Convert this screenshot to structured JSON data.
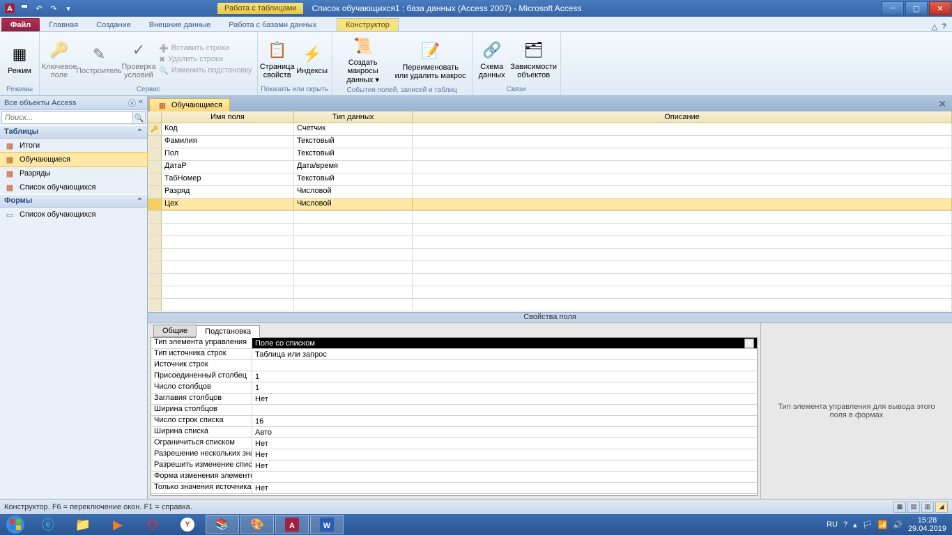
{
  "window": {
    "context_tab": "Работа с таблицами",
    "title": "Список обучающихся1 : база данных (Access 2007)  -  Microsoft Access"
  },
  "ribbon_tabs": {
    "file": "Файл",
    "home": "Главная",
    "create": "Создание",
    "external": "Внешние данные",
    "dbtools": "Работа с базами данных",
    "design": "Конструктор"
  },
  "ribbon": {
    "g1": {
      "mode": "Режим",
      "label": "Режимы"
    },
    "g2": {
      "key": "Ключевое\nполе",
      "builder": "Построитель",
      "check": "Проверка\nусловий",
      "ins": "Вставить строки",
      "del": "Удалить строки",
      "mod": "Изменить подстановку",
      "label": "Сервис"
    },
    "g3": {
      "props": "Страница\nсвойств",
      "idx": "Индексы",
      "label": "Показать или скрыть"
    },
    "g4": {
      "create": "Создать макросы\nданных ▾",
      "rename": "Переименовать\nили удалить макрос",
      "label": "События полей, записей и таблиц"
    },
    "g5": {
      "schema": "Схема\nданных",
      "deps": "Зависимости\nобъектов",
      "label": "Связи"
    }
  },
  "nav": {
    "header": "Все объекты Access",
    "search_ph": "Поиск...",
    "cat_tables": "Таблицы",
    "cat_forms": "Формы",
    "tables": [
      "Итоги",
      "Обучающиеся",
      "Разряды",
      "Список обучающихся"
    ],
    "forms": [
      "Список обучающихся"
    ]
  },
  "doc": {
    "tab_name": "Обучающиеся",
    "col_field": "Имя поля",
    "col_type": "Тип данных",
    "col_desc": "Описание",
    "rows": [
      {
        "fn": "Код",
        "dt": "Счетчик",
        "pk": true
      },
      {
        "fn": "Фамилия",
        "dt": "Текстовый"
      },
      {
        "fn": "Пол",
        "dt": "Текстовый"
      },
      {
        "fn": "ДатаР",
        "dt": "Дата/время"
      },
      {
        "fn": "ТабНомер",
        "dt": "Текстовый"
      },
      {
        "fn": "Разряд",
        "dt": "Числовой"
      },
      {
        "fn": "Цех",
        "dt": "Числовой",
        "selected": true
      }
    ],
    "prop_section": "Свойства поля"
  },
  "props": {
    "tab_general": "Общие",
    "tab_lookup": "Подстановка",
    "help": "Тип элемента управления для вывода этого поля в формах",
    "rows": [
      {
        "l": "Тип элемента управления",
        "v": "Поле со списком",
        "edit": true,
        "dd": true
      },
      {
        "l": "Тип источника строк",
        "v": "Таблица или запрос"
      },
      {
        "l": "Источник строк",
        "v": ""
      },
      {
        "l": "Присоединенный столбец",
        "v": "1"
      },
      {
        "l": "Число столбцов",
        "v": "1"
      },
      {
        "l": "Заглавия столбцов",
        "v": "Нет"
      },
      {
        "l": "Ширина столбцов",
        "v": ""
      },
      {
        "l": "Число строк списка",
        "v": "16"
      },
      {
        "l": "Ширина списка",
        "v": "Авто"
      },
      {
        "l": "Ограничиться списком",
        "v": "Нет"
      },
      {
        "l": "Разрешение нескольких значений",
        "v": "Нет"
      },
      {
        "l": "Разрешить изменение списка значений",
        "v": "Нет"
      },
      {
        "l": "Форма изменения элементов списка",
        "v": ""
      },
      {
        "l": "Только значения источника строк",
        "v": "Нет"
      }
    ]
  },
  "status": "Конструктор.  F6 = переключение окон.  F1 = справка.",
  "tray": {
    "lang": "RU",
    "time": "15:28",
    "date": "29.04.2019"
  }
}
